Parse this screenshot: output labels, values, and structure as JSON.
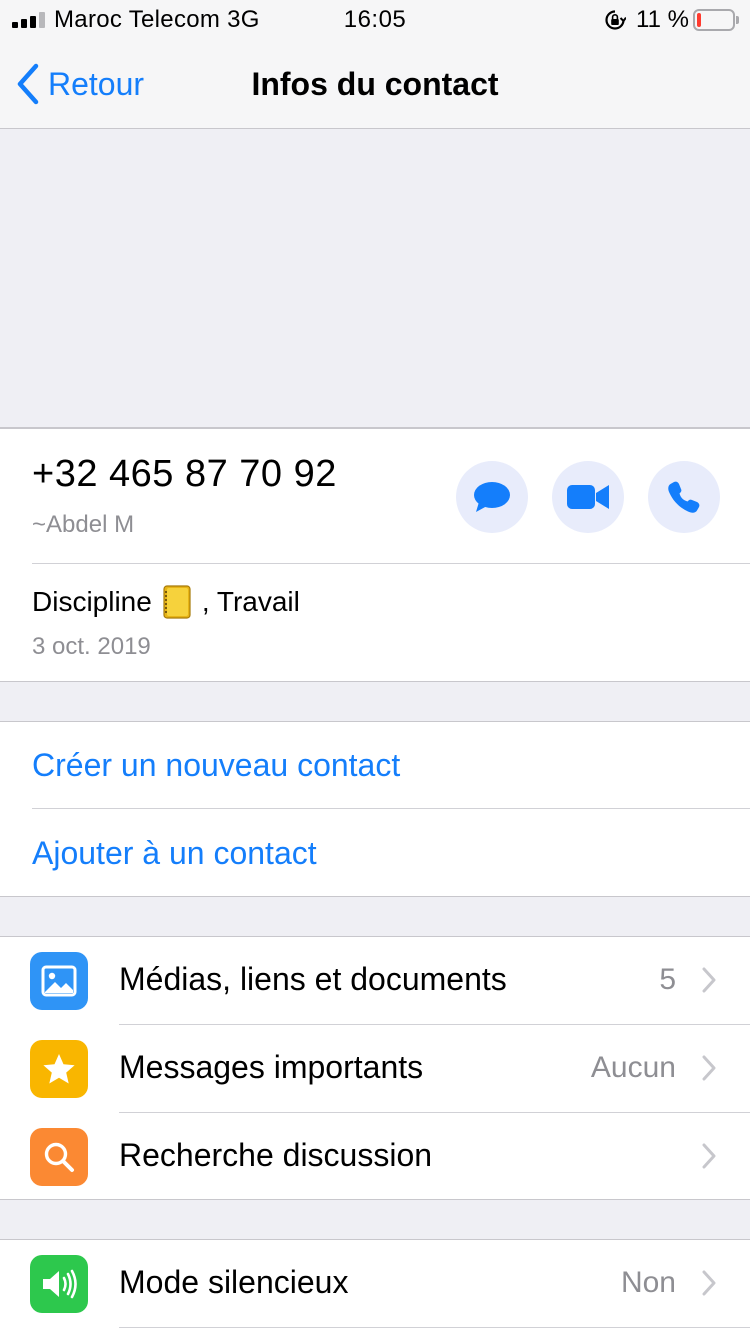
{
  "status_bar": {
    "carrier": "Maroc Telecom 3G",
    "time": "16:05",
    "battery": "11 %",
    "battery_level": 0.11
  },
  "nav": {
    "back_label": "Retour",
    "title": "Infos du contact"
  },
  "contact": {
    "phone": "+32 465 87 70 92",
    "pushname": "~Abdel M",
    "about_part1": "Discipline",
    "about_emoji": "notebook-emoji",
    "about_part2": ", Travail",
    "about_date": "3 oct. 2019",
    "actions": [
      "message-icon",
      "video-call-icon",
      "phone-call-icon"
    ]
  },
  "contact_actions": {
    "create": "Créer un nouveau contact",
    "add": "Ajouter à un contact"
  },
  "menu": {
    "media": {
      "label": "Médias, liens et documents",
      "value": "5",
      "icon": "photo-icon",
      "color": "#2f94f6"
    },
    "starred": {
      "label": "Messages importants",
      "value": "Aucun",
      "icon": "star-icon",
      "color": "#f9b600"
    },
    "search": {
      "label": "Recherche discussion",
      "value": "",
      "icon": "search-icon",
      "color": "#fb8933"
    },
    "mute": {
      "label": "Mode silencieux",
      "value": "Non",
      "icon": "speaker-icon",
      "color": "#2dc84d"
    }
  },
  "colors": {
    "accent": "#147efb",
    "background": "#efeff4",
    "battery_low": "#ff3b30"
  }
}
